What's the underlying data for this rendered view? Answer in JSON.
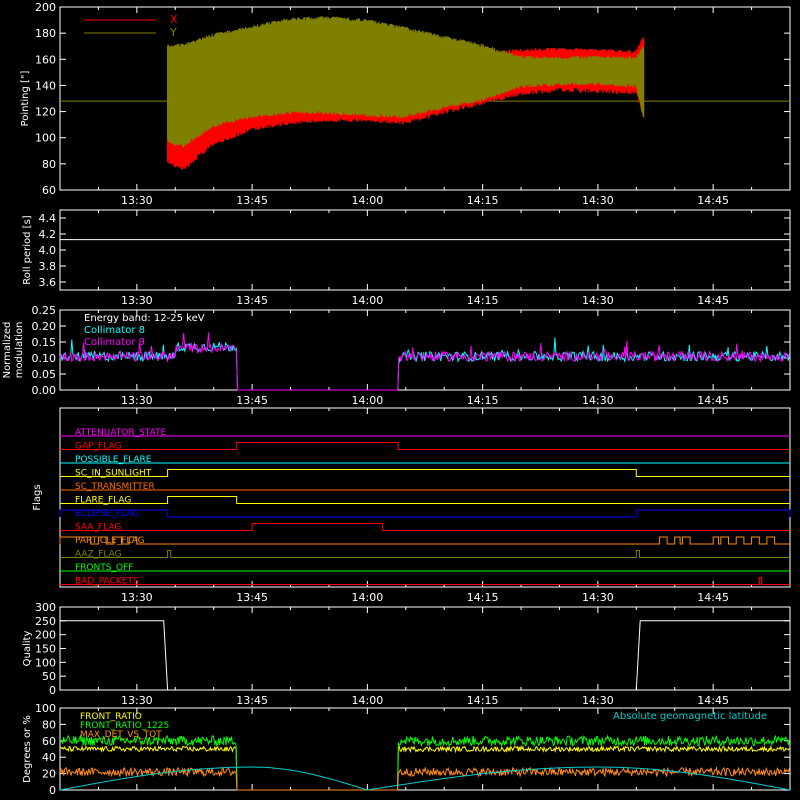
{
  "colors": {
    "background": "#000000",
    "axes": "#ffffff",
    "x_pointing": "#ff0000",
    "y_pointing": "#808000",
    "collimator8": "#00ffff",
    "collimator9": "#ff00ff",
    "quality": "#ffffff",
    "front_ratio": "#ffff00",
    "front_ratio_1225": "#00ff00",
    "max_det_vs_tot": "#ff8c1a",
    "geomag_lat": "#00cccc"
  },
  "chart_data": [
    {
      "id": "pointing",
      "type": "line",
      "ylabel": "Pointing [\"]",
      "ylim": [
        60,
        200
      ],
      "yticks": [
        60,
        80,
        100,
        120,
        140,
        160,
        180,
        200
      ],
      "x_tick_labels": [
        "13:30",
        "13:45",
        "14:00",
        "14:15",
        "14:30",
        "14:45"
      ],
      "legend": [
        "X",
        "Y"
      ],
      "legend_position": "top-left",
      "series": [
        {
          "name": "X",
          "color_key": "x_pointing",
          "x": [
            "13:34",
            "13:36",
            "13:40",
            "13:45",
            "13:50",
            "13:55",
            "14:00",
            "14:05",
            "14:10",
            "14:15",
            "14:20",
            "14:25",
            "14:30",
            "14:35",
            "14:36"
          ],
          "upper": [
            168,
            165,
            168,
            170,
            170,
            170,
            170,
            170,
            168,
            166,
            168,
            169,
            168,
            167,
            180
          ],
          "lower": [
            80,
            74,
            94,
            105,
            110,
            112,
            112,
            110,
            118,
            125,
            132,
            135,
            134,
            133,
            115
          ]
        },
        {
          "name": "Y",
          "color_key": "y_pointing",
          "x": [
            "13:34",
            "13:36",
            "13:40",
            "13:45",
            "13:50",
            "13:55",
            "14:00",
            "14:05",
            "14:10",
            "14:15",
            "14:20",
            "14:25",
            "14:30",
            "14:35",
            "14:36"
          ],
          "upper": [
            172,
            172,
            180,
            186,
            192,
            193,
            191,
            185,
            178,
            172,
            163,
            162,
            163,
            162,
            172
          ],
          "lower": [
            96,
            92,
            108,
            115,
            118,
            118,
            116,
            115,
            122,
            128,
            138,
            140,
            140,
            138,
            112
          ],
          "baseline": 128
        }
      ]
    },
    {
      "id": "roll",
      "type": "line",
      "ylabel": "Roll period [s]",
      "ylim": [
        3.5,
        4.5
      ],
      "yticks": [
        3.6,
        3.8,
        4.0,
        4.2,
        4.4
      ],
      "x_tick_labels": [
        "13:30",
        "13:45",
        "14:00",
        "14:15",
        "14:30",
        "14:45"
      ],
      "series": [
        {
          "x": [
            "13:20",
            "14:55"
          ],
          "values": [
            4.13,
            4.13
          ]
        }
      ]
    },
    {
      "id": "modulation",
      "type": "line",
      "ylabel": "Normalized modulation",
      "ylim": [
        0,
        0.25
      ],
      "yticks": [
        0.0,
        0.05,
        0.1,
        0.15,
        0.2,
        0.25
      ],
      "x_tick_labels": [
        "13:30",
        "13:45",
        "14:00",
        "14:15",
        "14:30",
        "14:45"
      ],
      "annotations": [
        "Energy band: 12-25 keV"
      ],
      "legend": [
        "Collimator 8",
        "Collimator 9"
      ],
      "gap": [
        "13:43",
        "14:04"
      ],
      "series": [
        {
          "name": "Collimator 8",
          "color_key": "collimator8",
          "baseline": 0.105,
          "noise": 0.03,
          "bump": [
            "13:35",
            "13:43",
            0.135
          ]
        },
        {
          "name": "Collimator 9",
          "color_key": "collimator9",
          "baseline": 0.105,
          "noise": 0.03,
          "bump": [
            "13:35",
            "13:43",
            0.13
          ]
        }
      ]
    },
    {
      "id": "flags",
      "type": "line",
      "ylabel": "Flags",
      "x_tick_labels": [
        "13:30",
        "13:45",
        "14:00",
        "14:15",
        "14:30",
        "14:45"
      ],
      "flags": [
        {
          "name": "ATTENUATOR_STATE",
          "color": "#ff00ff",
          "on": []
        },
        {
          "name": "GAP_FLAG",
          "color": "#ff0000",
          "on": [
            [
              "13:43",
              "14:04"
            ]
          ]
        },
        {
          "name": "POSSIBLE_FLARE",
          "color": "#00ffff",
          "on": []
        },
        {
          "name": "SC_IN_SUNLIGHT",
          "color": "#ffff00",
          "on": [
            [
              "13:34",
              "14:35"
            ]
          ]
        },
        {
          "name": "SC_TRANSMITTER",
          "color": "#ff6a00",
          "on": []
        },
        {
          "name": "FLARE_FLAG",
          "color": "#ffff00",
          "on": [
            [
              "13:34",
              "13:43"
            ]
          ]
        },
        {
          "name": "ECLIPSE_FLAG",
          "color": "#0000ff",
          "on": [
            [
              "13:20",
              "13:34"
            ],
            [
              "14:35",
              "14:55"
            ]
          ]
        },
        {
          "name": "SAA_FLAG",
          "color": "#ff0000",
          "on": [
            [
              "13:45",
              "14:02"
            ]
          ]
        },
        {
          "name": "PARTICLE_FLAG",
          "color": "#ff8c00",
          "on": [
            [
              "13:20",
              "13:24"
            ],
            [
              "13:25",
              "13:26"
            ],
            [
              "13:27",
              "13:28"
            ],
            [
              "13:29",
              "13:30"
            ],
            [
              "14:38",
              "14:39"
            ],
            [
              "14:40",
              "14:40.7"
            ],
            [
              "14:41",
              "14:42"
            ],
            [
              "14:45",
              "14:45.7"
            ],
            [
              "14:46",
              "14:47"
            ],
            [
              "14:48",
              "14:49"
            ],
            [
              "14:50",
              "14:51"
            ],
            [
              "14:52",
              "14:53"
            ]
          ]
        },
        {
          "name": "AAZ_FLAG",
          "color": "#808000",
          "on": [
            [
              "13:34",
              "13:34.4"
            ],
            [
              "14:35",
              "14:35.4"
            ]
          ]
        },
        {
          "name": "FRONTS_OFF",
          "color": "#00ff00",
          "on": []
        },
        {
          "name": "BAD_PACKETS",
          "color": "#ff0000",
          "on": [
            [
              "14:51",
              "14:51.3"
            ]
          ]
        }
      ]
    },
    {
      "id": "quality",
      "type": "line",
      "ylabel": "Quality",
      "ylim": [
        0,
        300
      ],
      "yticks": [
        0,
        50,
        100,
        150,
        200,
        250,
        300
      ],
      "x_tick_labels": [
        "13:30",
        "13:45",
        "14:00",
        "14:15",
        "14:30",
        "14:45"
      ],
      "series": [
        {
          "color_key": "quality",
          "x": [
            "13:20",
            "13:33.5",
            "13:34",
            "14:35",
            "14:35.5",
            "14:55"
          ],
          "values": [
            250,
            250,
            0,
            0,
            250,
            250
          ]
        }
      ]
    },
    {
      "id": "ratios",
      "type": "line",
      "ylabel": "Degrees or %",
      "ylim": [
        0,
        100
      ],
      "yticks": [
        0,
        20,
        40,
        60,
        80,
        100
      ],
      "legend": [
        "FRONT_RATIO",
        "FRONT_RATIO_1225",
        "MAX_DET_VS_TOT"
      ],
      "annotations": [
        "Absolute geomagnetic latitude"
      ],
      "gap": [
        "13:43",
        "14:04"
      ],
      "series": [
        {
          "name": "FRONT_RATIO",
          "color_key": "front_ratio",
          "level": 50,
          "noise": 3
        },
        {
          "name": "FRONT_RATIO_1225",
          "color_key": "front_ratio_1225",
          "level": 60,
          "noise": 6
        },
        {
          "name": "MAX_DET_VS_TOT",
          "color_key": "max_det_vs_tot",
          "level": 22,
          "noise": 5
        },
        {
          "name": "Absolute geomagnetic latitude",
          "color_key": "geomag_lat",
          "x": [
            "13:20",
            "13:45",
            "14:00",
            "14:30",
            "14:55"
          ],
          "values": [
            0,
            28,
            0,
            28,
            0
          ]
        }
      ]
    }
  ]
}
